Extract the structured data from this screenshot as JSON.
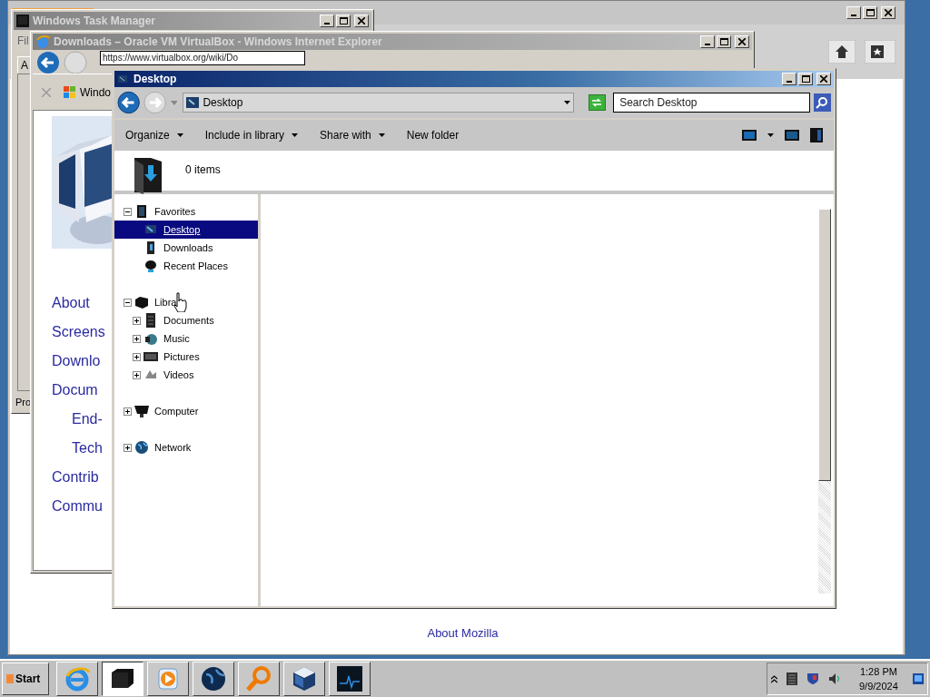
{
  "back_window": {
    "link": "About Mozilla"
  },
  "task_manager": {
    "title": "Windows Task Manager",
    "menu": "Fil",
    "tab": "A",
    "status": "Pro"
  },
  "browser": {
    "title": "Downloads – Oracle VM VirtualBox - Windows Internet Explorer",
    "address": "https://www.virtualbox.org/wiki/Do",
    "tab": "Windo",
    "links": [
      {
        "label": "About",
        "kind": "top"
      },
      {
        "label": "Screens",
        "kind": "top"
      },
      {
        "label": "Downlo",
        "kind": "top"
      },
      {
        "label": "Docum",
        "kind": "top"
      },
      {
        "label": "End-",
        "kind": "sub"
      },
      {
        "label": "Tech",
        "kind": "sub"
      },
      {
        "label": "Contrib",
        "kind": "top"
      },
      {
        "label": "Commu",
        "kind": "top"
      }
    ]
  },
  "explorer": {
    "title": "Desktop",
    "path": "Desktop",
    "search": {
      "placeholder": "Search Desktop"
    },
    "toolbar": [
      {
        "label": "Organize",
        "dropdown": true
      },
      {
        "label": "Include in library",
        "dropdown": true
      },
      {
        "label": "Share with",
        "dropdown": true
      },
      {
        "label": "New folder",
        "dropdown": false
      }
    ],
    "item_count": "0 items",
    "nav": [
      {
        "label": "Favorites",
        "kind": "star",
        "expanded": true,
        "selected": false,
        "children": [
          {
            "label": "Desktop",
            "kind": "desktop",
            "selected": true
          },
          {
            "label": "Downloads",
            "kind": "download",
            "selected": false
          },
          {
            "label": "Recent Places",
            "kind": "recent",
            "selected": false
          }
        ]
      },
      {
        "label": "Libra",
        "kind": "library",
        "expanded": true,
        "selected": false,
        "children": [
          {
            "label": "Documents",
            "kind": "docs",
            "expanded": false,
            "selected": false
          },
          {
            "label": "Music",
            "kind": "music",
            "expanded": false,
            "selected": false
          },
          {
            "label": "Pictures",
            "kind": "pictures",
            "expanded": false,
            "selected": false
          },
          {
            "label": "Videos",
            "kind": "videos",
            "expanded": false,
            "selected": false
          }
        ]
      },
      {
        "label": "Computer",
        "kind": "computer",
        "expanded": false,
        "selected": false
      },
      {
        "label": "Network",
        "kind": "network",
        "expanded": false,
        "selected": false
      }
    ]
  },
  "taskbar": {
    "start": "Start",
    "apps": [
      {
        "kind": "ie",
        "selected": false
      },
      {
        "kind": "explorer",
        "selected": true
      },
      {
        "kind": "media",
        "selected": false
      },
      {
        "kind": "globe",
        "selected": false
      },
      {
        "kind": "magnifier",
        "selected": false
      },
      {
        "kind": "cube",
        "selected": false
      },
      {
        "kind": "monitor",
        "selected": false
      }
    ],
    "time": "1:28 PM",
    "date": "9/9/2024"
  }
}
